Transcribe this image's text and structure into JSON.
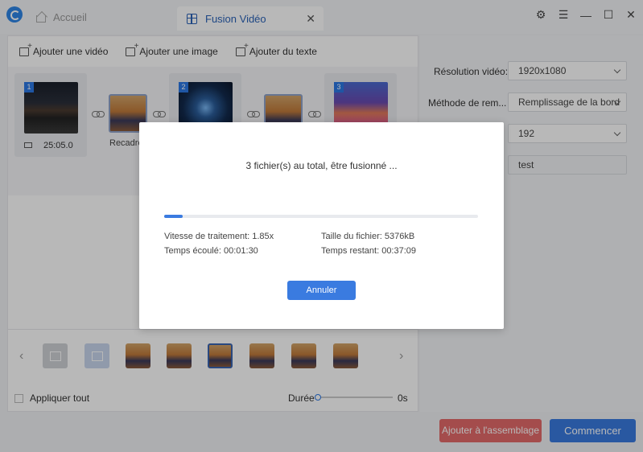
{
  "titlebar": {
    "home_tab": "Accueil",
    "active_tab": "Fusion Vidéo",
    "close": "✕"
  },
  "toolbar": {
    "add_video": "Ajouter une vidéo",
    "add_image": "Ajouter une image",
    "add_text": "Ajouter du texte"
  },
  "clips": [
    {
      "number": "1",
      "duration": "25:05.0"
    },
    {
      "number": "2"
    },
    {
      "number": "3"
    }
  ],
  "transition_label": "Recadre",
  "bottom": {
    "apply_all": "Appliquer tout",
    "duration_label": "Durée",
    "duration_value": "0s",
    "duration_fraction": 0
  },
  "settings": {
    "resolution_label": "Résolution vidéo:",
    "resolution_value": "1920x1080",
    "method_label": "Méthode de rem...",
    "method_value": "Remplissage de la bord",
    "bitrate_value": "192",
    "name_value": "test"
  },
  "buttons": {
    "add_to_assembly": "Ajouter à l'assemblage",
    "start": "Commencer"
  },
  "modal": {
    "title": "3 fichier(s) au total, être fusionné ...",
    "progress_fraction": 0.06,
    "speed": "Vitesse de traitement: 1.85x",
    "file_size": "Taille du fichier: 5376kB",
    "elapsed": "Temps écoulé: 00:01:30",
    "remaining": "Temps restant: 00:37:09",
    "cancel": "Annuler"
  },
  "colors": {
    "accent": "#3a7be0",
    "danger": "#e46a6a"
  }
}
